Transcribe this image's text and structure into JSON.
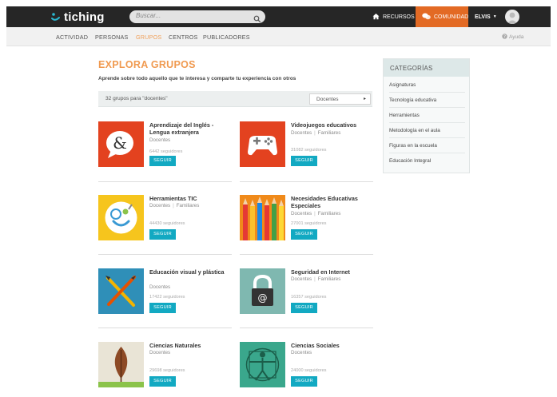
{
  "header": {
    "logo_text": "tiching",
    "search_placeholder": "Buscar...",
    "nav_recursos": "RECURSOS",
    "nav_comunidad": "COMUNIDAD",
    "user_name": "ELVIS",
    "accent_orange": "#e36a24",
    "accent_teal": "#12a9c2"
  },
  "subnav": {
    "items": [
      {
        "label": "ACTIVIDAD",
        "active": false
      },
      {
        "label": "PERSONAS",
        "active": false
      },
      {
        "label": "GRUPOS",
        "active": true
      },
      {
        "label": "CENTROS",
        "active": false
      },
      {
        "label": "PUBLICADORES",
        "active": false
      }
    ],
    "help": "Ayuda"
  },
  "main": {
    "title": "EXPLORA GRUPOS",
    "subtitle": "Aprende sobre todo aquello que te interesa y comparte tu experiencia con otros",
    "results_text": "32 grupos para \"docentes\"",
    "filter_value": "Docentes"
  },
  "groups": [
    {
      "title": "Aprendizaje del Inglés - Lengua extranjera",
      "tags": [
        "Docentes"
      ],
      "followers": "6442 seguidores",
      "button": "SEGUIR",
      "icon": "ampersand-speech-icon"
    },
    {
      "title": "Videojuegos educativos",
      "tags": [
        "Docentes",
        "Familiares"
      ],
      "followers": "31082 seguidores",
      "button": "SEGUIR",
      "icon": "gamepad-icon"
    },
    {
      "title": "Herramientas TIC",
      "tags": [
        "Docentes",
        "Familiares"
      ],
      "followers": "44430 seguidores",
      "button": "SEGUIR",
      "icon": "smiley-tools-icon"
    },
    {
      "title": "Necesidades Educativas Especiales",
      "tags": [
        "Docentes",
        "Familiares"
      ],
      "followers": "27001 seguidores",
      "button": "SEGUIR",
      "icon": "crayons-icon"
    },
    {
      "title": "Educación visual y plástica",
      "tags": [
        "Docentes"
      ],
      "followers": "17422 seguidores",
      "button": "SEGUIR",
      "icon": "brush-pencil-icon"
    },
    {
      "title": "Seguridad en Internet",
      "tags": [
        "Docentes",
        "Familiares"
      ],
      "followers": "16357 seguidores",
      "button": "SEGUIR",
      "icon": "padlock-icon"
    },
    {
      "title": "Ciencias Naturales",
      "tags": [
        "Docentes"
      ],
      "followers": "29698 seguidores",
      "button": "SEGUIR",
      "icon": "leaf-icon"
    },
    {
      "title": "Ciencias Sociales",
      "tags": [
        "Docentes"
      ],
      "followers": "24000 seguidores",
      "button": "SEGUIR",
      "icon": "vitruvian-man-icon"
    }
  ],
  "sidebar": {
    "title": "CATEGORÍAS",
    "items": [
      "Asignaturas",
      "Tecnología educativa",
      "Herramientas",
      "Metodología en el aula",
      "Figuras en la escuela",
      "Educación Integral"
    ]
  }
}
